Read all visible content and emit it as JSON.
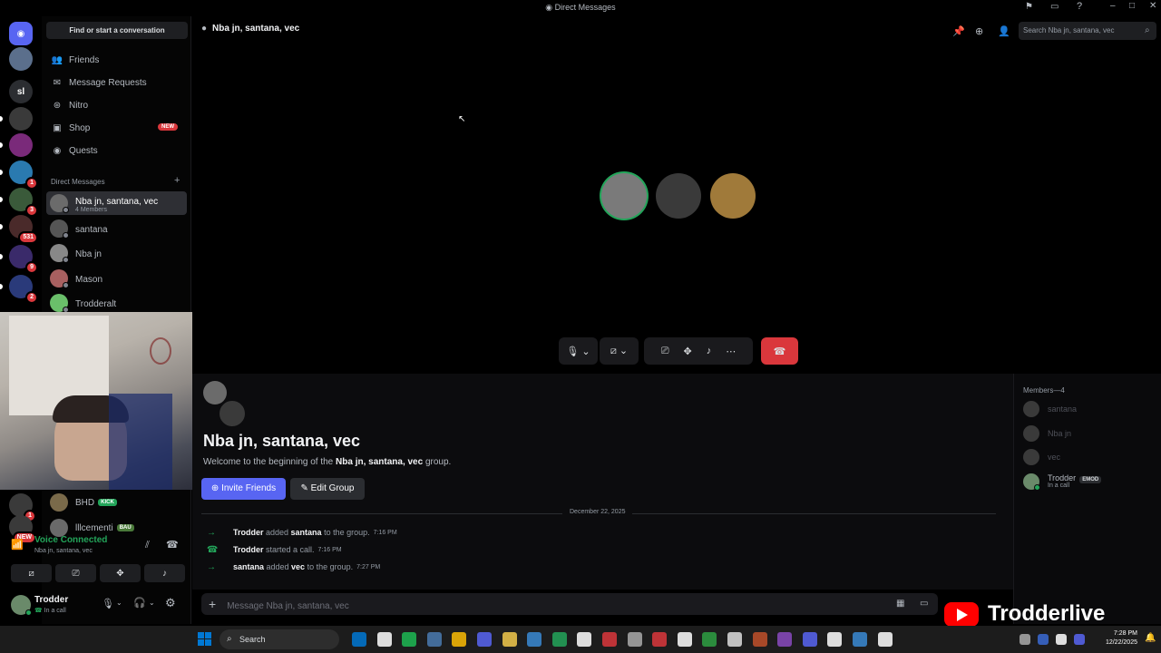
{
  "window": {
    "title": "Direct Messages"
  },
  "servers": {
    "items": [
      {
        "label": "discord-home",
        "color": "#5865f2",
        "badge": ""
      },
      {
        "label": "avatar",
        "color": "#5b6f8c",
        "badge": ""
      },
      {
        "label": "sl",
        "color": "#2b2d31",
        "badge": ""
      },
      {
        "label": "",
        "color": "#3a3a3a",
        "badge": ""
      },
      {
        "label": "",
        "color": "#7a2a7a",
        "badge": ""
      },
      {
        "label": "",
        "color": "#2a7ab0",
        "badge": "1"
      },
      {
        "label": "",
        "color": "#3a5a3a",
        "badge": "3"
      },
      {
        "label": "",
        "color": "#4a2a2a",
        "badge": "531"
      },
      {
        "label": "",
        "color": "#3a2a6a",
        "badge": "9"
      },
      {
        "label": "",
        "color": "#2a3a7a",
        "badge": "2"
      }
    ],
    "lower": [
      {
        "badge": "1"
      },
      {
        "badge": "NEW"
      }
    ]
  },
  "sidebar": {
    "find": "Find or start a conversation",
    "nav": [
      {
        "label": "Friends",
        "icon": "friends-icon",
        "glyph": "👥",
        "tag": ""
      },
      {
        "label": "Message Requests",
        "icon": "mail-icon",
        "glyph": "✉",
        "tag": ""
      },
      {
        "label": "Nitro",
        "icon": "nitro-icon",
        "glyph": "⊛",
        "tag": ""
      },
      {
        "label": "Shop",
        "icon": "shop-icon",
        "glyph": "▣",
        "tag": "NEW"
      },
      {
        "label": "Quests",
        "icon": "quests-icon",
        "glyph": "◉",
        "tag": ""
      }
    ],
    "dm_header": "Direct Messages",
    "dms": [
      {
        "name": "Nba jn, santana, vec",
        "sub": "4 Members",
        "color": "#6b6b6b",
        "active": true
      },
      {
        "name": "santana",
        "sub": "",
        "color": "#555555",
        "active": false
      },
      {
        "name": "Nba jn",
        "sub": "",
        "color": "#888888",
        "active": false
      },
      {
        "name": "Mason",
        "sub": "",
        "color": "#a86060",
        "active": false
      },
      {
        "name": "Trodderalt",
        "sub": "",
        "color": "#6abf6a",
        "active": false
      }
    ],
    "lower_dms": [
      {
        "name": "BHD",
        "tag": "KICK",
        "tag_color": "#23a55a",
        "color": "#7a6a4a"
      },
      {
        "name": "lllcementi",
        "tag": "BAU",
        "tag_color": "#4a7a3a",
        "color": "#6a6a6a"
      }
    ]
  },
  "voice": {
    "status": "Voice Connected",
    "channel": "Nba jn, santana, vec"
  },
  "user": {
    "name": "Trodder",
    "status": "In a call"
  },
  "channel": {
    "name": "Nba jn, santana, vec",
    "search_placeholder": "Search Nba jn, santana, vec"
  },
  "call": {
    "participants": [
      {
        "name": "participant-1",
        "color": "#7a7a7a",
        "speaking": true
      },
      {
        "name": "participant-2",
        "color": "#3a3a3a",
        "speaking": false
      },
      {
        "name": "participant-3",
        "color": "#a07a3a",
        "speaking": false
      }
    ]
  },
  "chat": {
    "title": "Nba jn, santana, vec",
    "welcome_prefix": "Welcome to the beginning of the ",
    "welcome_group": "Nba jn, santana, vec",
    "welcome_suffix": " group.",
    "invite_label": "Invite Friends",
    "edit_label": "Edit Group",
    "date": "December 22, 2025",
    "messages": [
      {
        "icon": "→",
        "actor": "Trodder",
        "mid": " added ",
        "target": "santana",
        "end": " to the group.",
        "time": "7:16 PM"
      },
      {
        "icon": "☎",
        "actor": "Trodder",
        "mid": " started a call.",
        "target": "",
        "end": "",
        "time": "7:16 PM"
      },
      {
        "icon": "→",
        "actor": "santana",
        "mid": " added ",
        "target": "vec",
        "end": " to the group.",
        "time": "7:27 PM"
      }
    ],
    "input_placeholder": "Message Nba jn, santana, vec"
  },
  "members": {
    "header": "Members—4",
    "list": [
      {
        "name": "santana",
        "color": "#3a3a3a",
        "dim": true,
        "tag": "",
        "sub": ""
      },
      {
        "name": "Nba jn",
        "color": "#3a3a3a",
        "dim": true,
        "tag": "",
        "sub": ""
      },
      {
        "name": "vec",
        "color": "#3a3a3a",
        "dim": true,
        "tag": "",
        "sub": ""
      },
      {
        "name": "Trodder",
        "color": "#6a8a6a",
        "dim": false,
        "tag": "EMOD",
        "sub": "In a call"
      }
    ]
  },
  "taskbar": {
    "search": "Search",
    "time": "7:28 PM",
    "date": "12/22/2025",
    "icons": [
      "#0078d4",
      "#ffffff",
      "#1db954",
      "#4a7ab0",
      "#fbbc05",
      "#5865f2",
      "#f2c94c",
      "#3a8ad4",
      "#23a55a",
      "#ffffff",
      "#da373c",
      "#aaaaaa",
      "#da373c",
      "#ffffff",
      "#2ea043",
      "#dddddd",
      "#c0502a",
      "#8a4ac0",
      "#5865f2",
      "#ffffff",
      "#3a8ad4",
      "#ffffff",
      "#aaaaaa",
      "#3a6ad4",
      "#ffffff",
      "#5865f2"
    ]
  },
  "stream": {
    "brand": "Trodderlive"
  }
}
